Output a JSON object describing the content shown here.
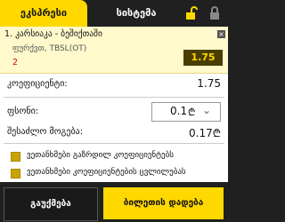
{
  "tabs": {
    "betslip": "ეკსპრესი",
    "system": "სისტემა"
  },
  "selection": {
    "title": "1. კარსიაკა - ბეშიქთაში",
    "market": "ფურქვთ, TBSL(OT)",
    "pick": "2",
    "odds": "1.75",
    "close": "×"
  },
  "coefficient": {
    "label": "კოეფიციენტი:",
    "value": "1.75"
  },
  "stake": {
    "label": "ფსონი:",
    "value": "0.1",
    "currency": "₾"
  },
  "possible_win": {
    "label": "შესაძლო მოგება:",
    "value": "0.17₾"
  },
  "options": [
    {
      "label": "ვეთანხმები გაზრდილ კოეფიციენტებს"
    },
    {
      "label": "ვეთანხმები კოეფიციენტების ცვლილებას"
    }
  ],
  "buttons": {
    "cancel": "გაუქმება",
    "place": "ბილეთის დადება"
  },
  "colors": {
    "accent": "#ffd800",
    "dark": "#202020",
    "highlight": "#fff9cc"
  }
}
